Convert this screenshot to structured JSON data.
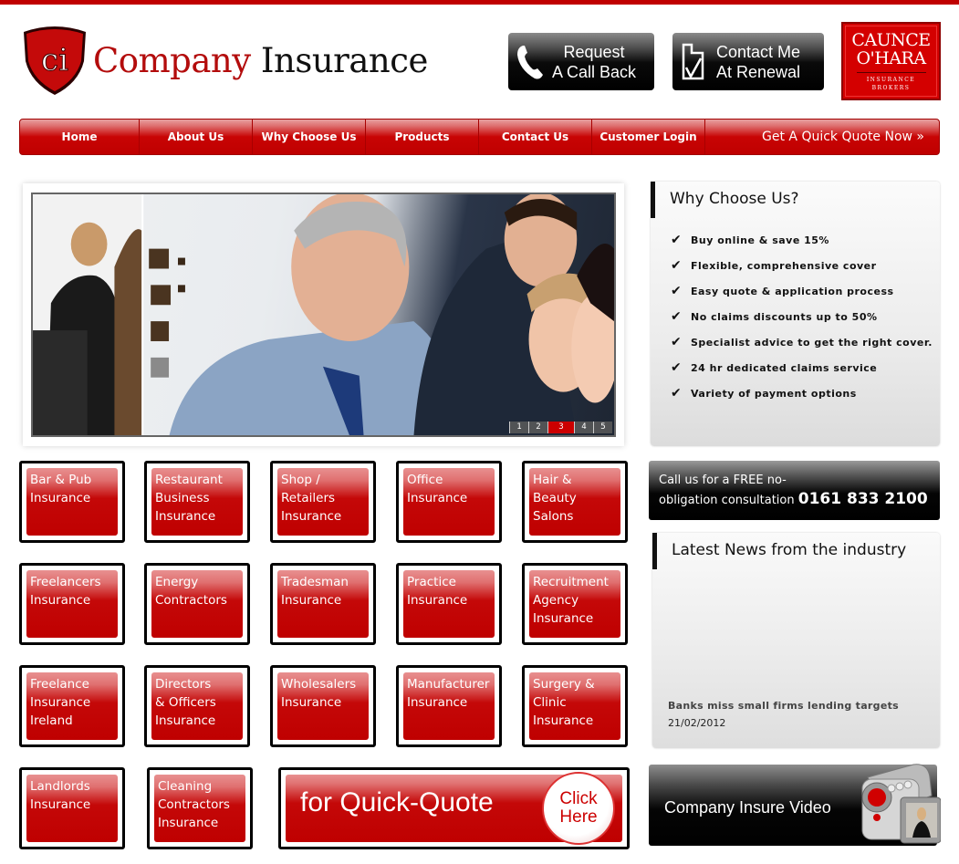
{
  "header": {
    "logo_monogram": "ci",
    "logo_word1": "Company",
    "logo_word2": "Insurance",
    "call_back": {
      "line1": "Request",
      "line2": "A Call Back",
      "icon": "phone-icon"
    },
    "renewal": {
      "line1": "Contact Me",
      "line2": "At Renewal",
      "icon": "checklist-icon"
    },
    "partner": {
      "line1": "CAUNCE",
      "line2": "O'HARA",
      "line3": "INSURANCE",
      "line4": "BROKERS"
    }
  },
  "nav": {
    "items": [
      "Home",
      "About Us",
      "Why Choose Us",
      "Products",
      "Contact Us",
      "Customer Login"
    ],
    "quote_label": "Get A Quick Quote Now »"
  },
  "slider": {
    "pages": [
      "1",
      "2",
      "3",
      "4",
      "5"
    ],
    "active_page": 3
  },
  "products": [
    "Bar & Pub\nInsurance",
    "Restaurant\nBusiness\nInsurance",
    "Shop /\nRetailers\nInsurance",
    "Office\nInsurance",
    "Hair &\nBeauty\nSalons",
    "Freelancers\nInsurance",
    "Energy\nContractors",
    "Tradesman\nInsurance",
    "Practice\nInsurance",
    "Recruitment\nAgency\nInsurance",
    "Freelance\nInsurance\nIreland",
    "Directors\n& Officers\nInsurance",
    "Wholesalers\nInsurance",
    "Manufacturer\nInsurance",
    "Surgery &\nClinic\nInsurance",
    "Landlords\nInsurance",
    "Cleaning\nContractors\nInsurance"
  ],
  "quick_quote": {
    "label": "for Quick-Quote",
    "cta": "Click\nHere"
  },
  "why_choose": {
    "title": "Why Choose Us?",
    "items": [
      "Buy online & save 15%",
      "Flexible, comprehensive cover",
      "Easy quote & application process",
      "No claims discounts up to 50%",
      "Specialist advice to get the right cover.",
      "24 hr dedicated claims service",
      "Variety of payment options"
    ]
  },
  "call_us": {
    "line1": "Call us for a FREE no-",
    "line2": "obligation consultation",
    "phone": "0161 833 2100"
  },
  "news": {
    "title": "Latest News from the industry",
    "headline": "Banks miss small firms lending targets",
    "date": "21/02/2012"
  },
  "video": {
    "label": "Company Insure Video"
  },
  "colors": {
    "brand_red": "#c00000",
    "dark": "#000000"
  }
}
